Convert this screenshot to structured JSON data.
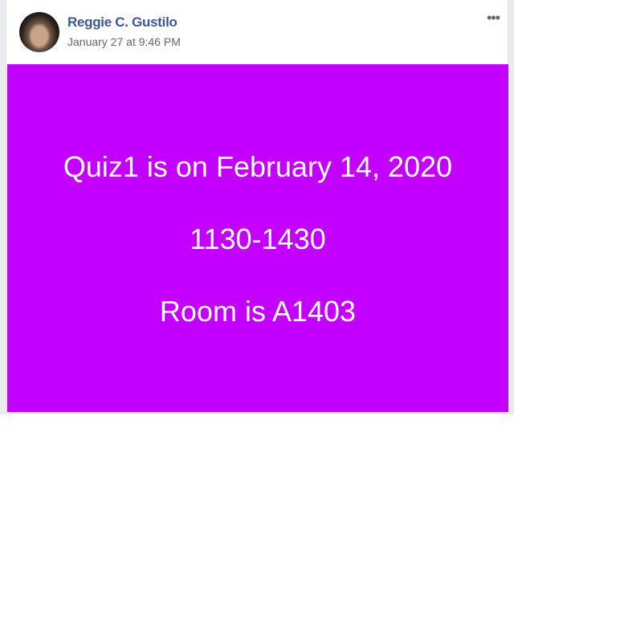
{
  "post": {
    "author": "Reggie C. Gustilo",
    "timestamp": "January 27 at 9:46 PM",
    "more_icon": "ellipsis-icon",
    "more_label": "•••",
    "image": {
      "background_color": "#c300ff",
      "lines": [
        "Quiz1 is on February 14, 2020",
        "1130-1430",
        "Room is A1403"
      ]
    }
  }
}
